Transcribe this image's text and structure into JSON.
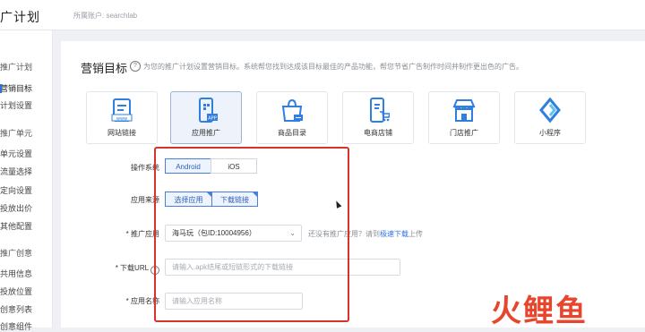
{
  "header": {
    "title": "广计划",
    "breadcrumb": "所属账户: searchlab"
  },
  "sidebar": {
    "items": [
      {
        "label": "推广计划"
      },
      {
        "label": "营销目标"
      },
      {
        "label": "计划设置"
      },
      {
        "label": "推广单元"
      },
      {
        "label": "单元设置"
      },
      {
        "label": "流量选择"
      },
      {
        "label": "定向设置"
      },
      {
        "label": "投放出价"
      },
      {
        "label": "其他配置"
      },
      {
        "label": "推广创意"
      },
      {
        "label": "共用信息"
      },
      {
        "label": "投放位置"
      },
      {
        "label": "创意列表"
      },
      {
        "label": "创意组件"
      }
    ]
  },
  "section": {
    "title": "营销目标",
    "description": "为您的推广计划设置营销目标。系统帮您找到达成该目标最佳的产品功能，帮您节省广告制作时间并制作更出色的广告。"
  },
  "goals": [
    {
      "label": "网站链接",
      "icon": "website-link-icon"
    },
    {
      "label": "应用推广",
      "icon": "app-promotion-icon",
      "selected": true
    },
    {
      "label": "商品目录",
      "icon": "product-catalog-icon"
    },
    {
      "label": "电商店铺",
      "icon": "ecommerce-store-icon"
    },
    {
      "label": "门店推广",
      "icon": "store-promotion-icon"
    },
    {
      "label": "小程序",
      "icon": "mini-program-icon"
    }
  ],
  "form": {
    "os": {
      "label": "操作系统",
      "options": [
        "Android",
        "iOS"
      ],
      "selected": "Android"
    },
    "source": {
      "label": "应用来源",
      "options": [
        "选择应用",
        "下载链接"
      ],
      "selected": "选择应用"
    },
    "app": {
      "label": "* 推广应用",
      "value": "海马玩（包ID:10004956）",
      "hint_prefix": "还没有推广应用？请到",
      "hint_link": "极速下载",
      "hint_suffix": "上传"
    },
    "url": {
      "label": "* 下载URL",
      "placeholder": "请输入.apk结尾或短链形式的下载链接"
    },
    "name": {
      "label": "* 应用名称",
      "placeholder": "请输入应用名称"
    }
  },
  "watermark": {
    "text": "火鲤鱼"
  },
  "colors": {
    "accent": "#2f6fe4",
    "highlight_box": "#d8322b",
    "watermark": "#e8452d"
  }
}
